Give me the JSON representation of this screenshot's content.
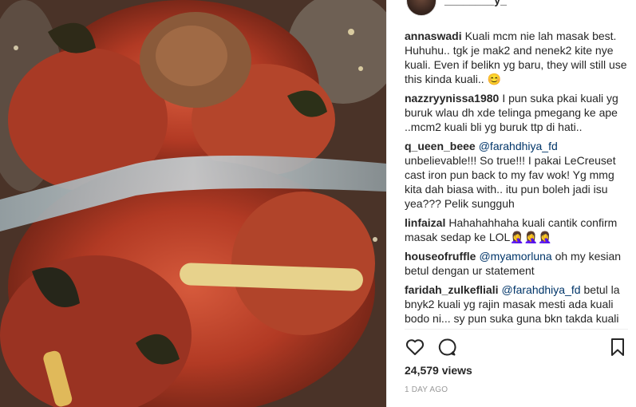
{
  "colors": {
    "mention": "#003569",
    "text": "#262626",
    "muted": "#999999"
  },
  "media": {
    "kind": "video-frame"
  },
  "header": {
    "username": "________y_"
  },
  "comments": [
    {
      "user": "annaswadi",
      "mention": "",
      "text": "Kuali mcm nie lah masak best. Huhuhu.. tgk je mak2 and nenek2 kite nye kuali. Even if belikn yg baru, they will still use this kinda kuali.. 😊"
    },
    {
      "user": "nazzryynissa1980",
      "mention": "",
      "text": "I pun suka pkai kuali yg buruk wlau dh xde telinga pmegang ke ape ..mcm2 kuali bli yg buruk ttp di hati.."
    },
    {
      "user": "q_ueen_beee",
      "mention": "@farahdhiya_fd",
      "text": "unbelievable!!! So true!!! I pakai LeCreuset cast iron pun back to my fav wok! Yg mmg kita dah biasa with.. itu pun boleh jadi isu yea??? Pelik sungguh"
    },
    {
      "user": "linfaizal",
      "mention": "",
      "text": "Hahahahhaha kuali cantik confirm masak sedap ke LOL🤦‍♀️🤦‍♀️🤦‍♀️"
    },
    {
      "user": "houseofruffle",
      "mention": "@myamorluna",
      "text": "oh my kesian betul dengan ur statement"
    },
    {
      "user": "faridah_zulkefliali",
      "mention": "@farahdhiya_fd",
      "text": "betul la bnyk2 kuali yg rajin masak mesti ada kuali bodo ni... sy pun suka guna bkn takda kuali"
    }
  ],
  "actions": {
    "like_icon": "heart-outline-icon",
    "comment_icon": "speech-bubble-icon",
    "save_icon": "bookmark-icon"
  },
  "views": "24,579 views",
  "timestamp": "1 DAY AGO"
}
